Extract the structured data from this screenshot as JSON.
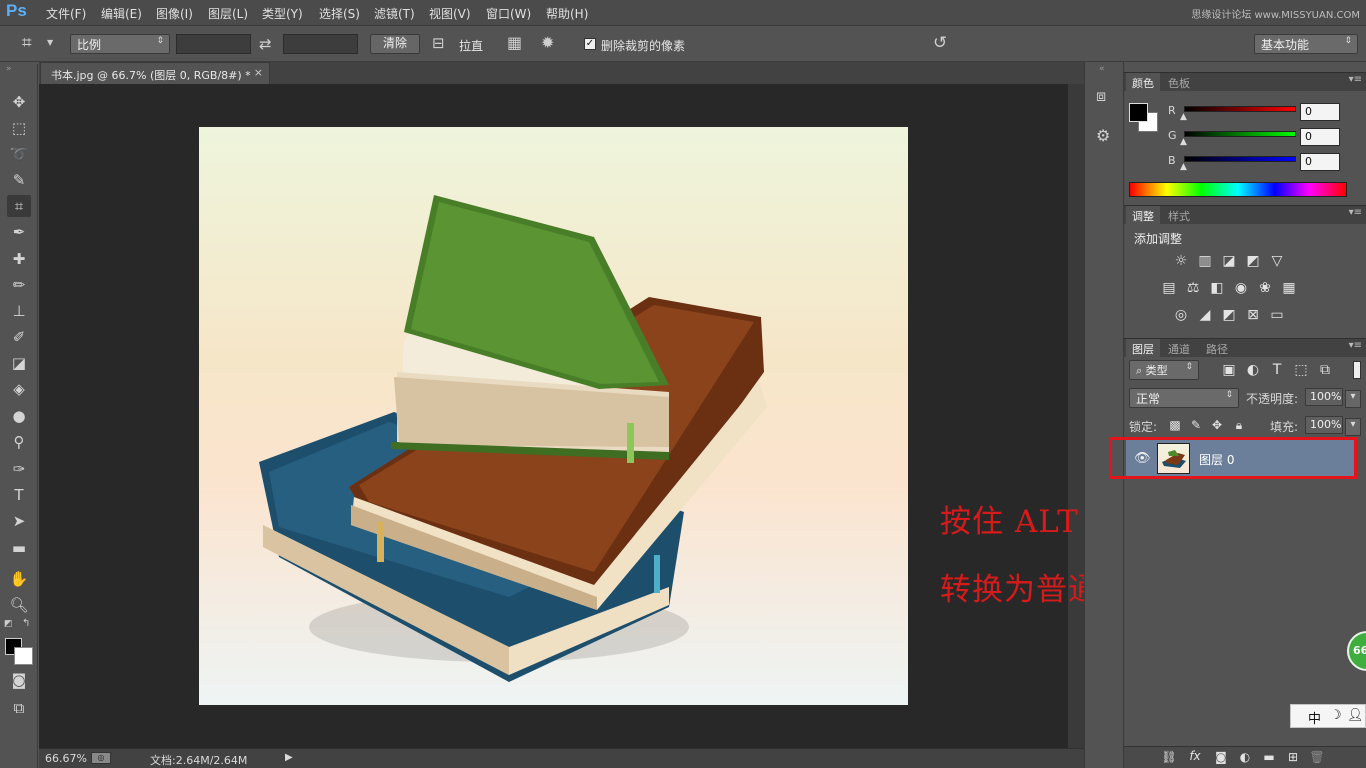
{
  "app": {
    "logo": "Ps"
  },
  "menu": [
    "文件(F)",
    "编辑(E)",
    "图像(I)",
    "图层(L)",
    "类型(Y)",
    "选择(S)",
    "滤镜(T)",
    "视图(V)",
    "窗口(W)",
    "帮助(H)"
  ],
  "watermark": "思缘设计论坛 www.MISSYUAN.COM",
  "options": {
    "ratio_select": "比例",
    "clear_button": "清除",
    "straighten_label": "拉直",
    "delete_cropped_checked": true,
    "delete_cropped_label": "删除裁剪的像素",
    "workspace_select": "基本功能"
  },
  "document": {
    "tab_title": "书本.jpg @ 66.7% (图层 0, RGB/8#) *",
    "zoom": "66.67%",
    "doc_size": "文档:2.64M/2.64M"
  },
  "annotation": {
    "line1": "按住 ALT 双击背景图层，",
    "line2": "转换为普通图层。"
  },
  "color_panel": {
    "tabs": [
      "颜色",
      "色板"
    ],
    "r_label": "R",
    "g_label": "G",
    "b_label": "B",
    "r": "0",
    "g": "0",
    "b": "0"
  },
  "adjust_panel": {
    "tabs": [
      "调整",
      "样式"
    ],
    "title": "添加调整"
  },
  "layers_panel": {
    "tabs": [
      "图层",
      "通道",
      "路径"
    ],
    "filter_kind": "类型",
    "blend_mode": "正常",
    "opacity_label": "不透明度:",
    "opacity": "100%",
    "lock_label": "锁定:",
    "fill_label": "填充:",
    "fill": "100%",
    "layer_name": "图层 0"
  },
  "badge": "66",
  "ime": "中"
}
